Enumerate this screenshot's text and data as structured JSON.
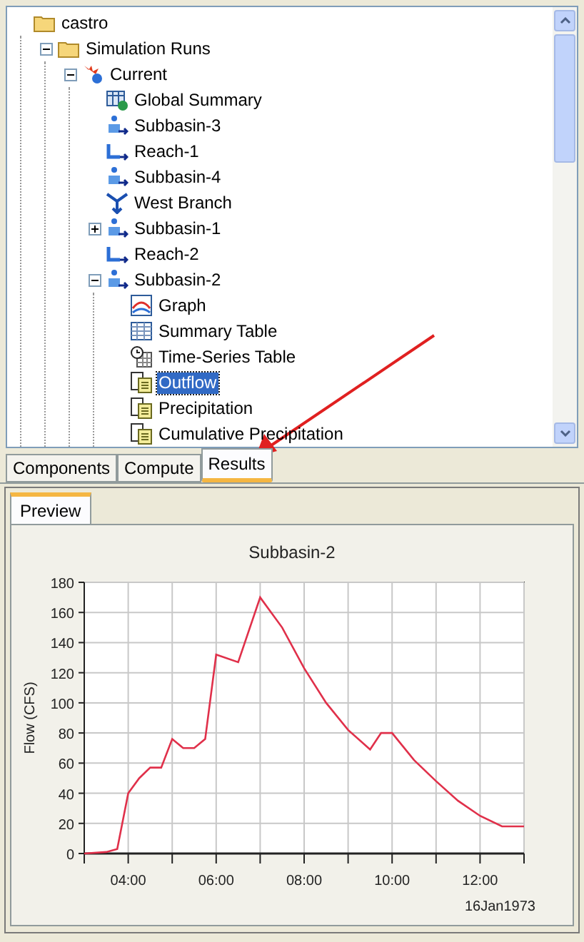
{
  "tree": [
    {
      "label": "castro",
      "kind": "folder",
      "selected": false,
      "children": [
        {
          "label": "Simulation Runs",
          "kind": "folder",
          "expanded": true,
          "selected": false,
          "children": [
            {
              "label": "Current",
              "kind": "run",
              "expanded": true,
              "selected": false,
              "children": [
                {
                  "label": "Global Summary",
                  "kind": "summary",
                  "selected": false
                },
                {
                  "label": "Subbasin-3",
                  "kind": "subbasin",
                  "selected": false
                },
                {
                  "label": "Reach-1",
                  "kind": "reach",
                  "selected": false
                },
                {
                  "label": "Subbasin-4",
                  "kind": "subbasin",
                  "selected": false
                },
                {
                  "label": "West Branch",
                  "kind": "junction",
                  "selected": false
                },
                {
                  "label": "Subbasin-1",
                  "kind": "subbasin",
                  "expanded": false,
                  "selected": false
                },
                {
                  "label": "Reach-2",
                  "kind": "reach",
                  "selected": false
                },
                {
                  "label": "Subbasin-2",
                  "kind": "subbasin",
                  "expanded": true,
                  "selected": false,
                  "children": [
                    {
                      "label": "Graph",
                      "kind": "graph",
                      "selected": false
                    },
                    {
                      "label": "Summary Table",
                      "kind": "table",
                      "selected": false
                    },
                    {
                      "label": "Time-Series Table",
                      "kind": "timeseries",
                      "selected": false
                    },
                    {
                      "label": "Outflow",
                      "kind": "result",
                      "selected": true
                    },
                    {
                      "label": "Precipitation",
                      "kind": "result",
                      "selected": false
                    },
                    {
                      "label": "Cumulative Precipitation",
                      "kind": "result",
                      "selected": false
                    }
                  ]
                }
              ]
            }
          ]
        }
      ]
    }
  ],
  "tabs": [
    {
      "label": "Components",
      "selected": false
    },
    {
      "label": "Compute",
      "selected": false
    },
    {
      "label": "Results",
      "selected": true
    }
  ],
  "preview": {
    "tab": {
      "label": "Preview",
      "selected": true
    },
    "chart_data": {
      "type": "line",
      "title": "Subbasin-2",
      "xlabel": "16Jan1973",
      "ylabel": "Flow (CFS)",
      "grid": true,
      "x": [
        3,
        3.5,
        3.75,
        4,
        4.25,
        4.5,
        4.75,
        5,
        5.25,
        5.5,
        5.75,
        6,
        6.5,
        7,
        7.25,
        7.5,
        8,
        8.5,
        9,
        9.5,
        9.75,
        10,
        10.5,
        11,
        11.5,
        12,
        12.5,
        13
      ],
      "series": [
        {
          "color": "#e0304a",
          "values": [
            0,
            1,
            3,
            40,
            50,
            57,
            57,
            76,
            70,
            70,
            76,
            132,
            127,
            170,
            160,
            150,
            123,
            100,
            82,
            69,
            80,
            80,
            62,
            48,
            35,
            25,
            18,
            18
          ]
        }
      ],
      "xlim": [
        3,
        13
      ],
      "ylim": [
        0,
        180
      ],
      "xticks": [
        {
          "value": 4,
          "label": "04:00"
        },
        {
          "value": 6,
          "label": "06:00"
        },
        {
          "value": 8,
          "label": "08:00"
        },
        {
          "value": 10,
          "label": "10:00"
        },
        {
          "value": 12,
          "label": "12:00"
        }
      ],
      "yticks": [
        0,
        20,
        40,
        60,
        80,
        100,
        120,
        140,
        160,
        180
      ]
    }
  }
}
